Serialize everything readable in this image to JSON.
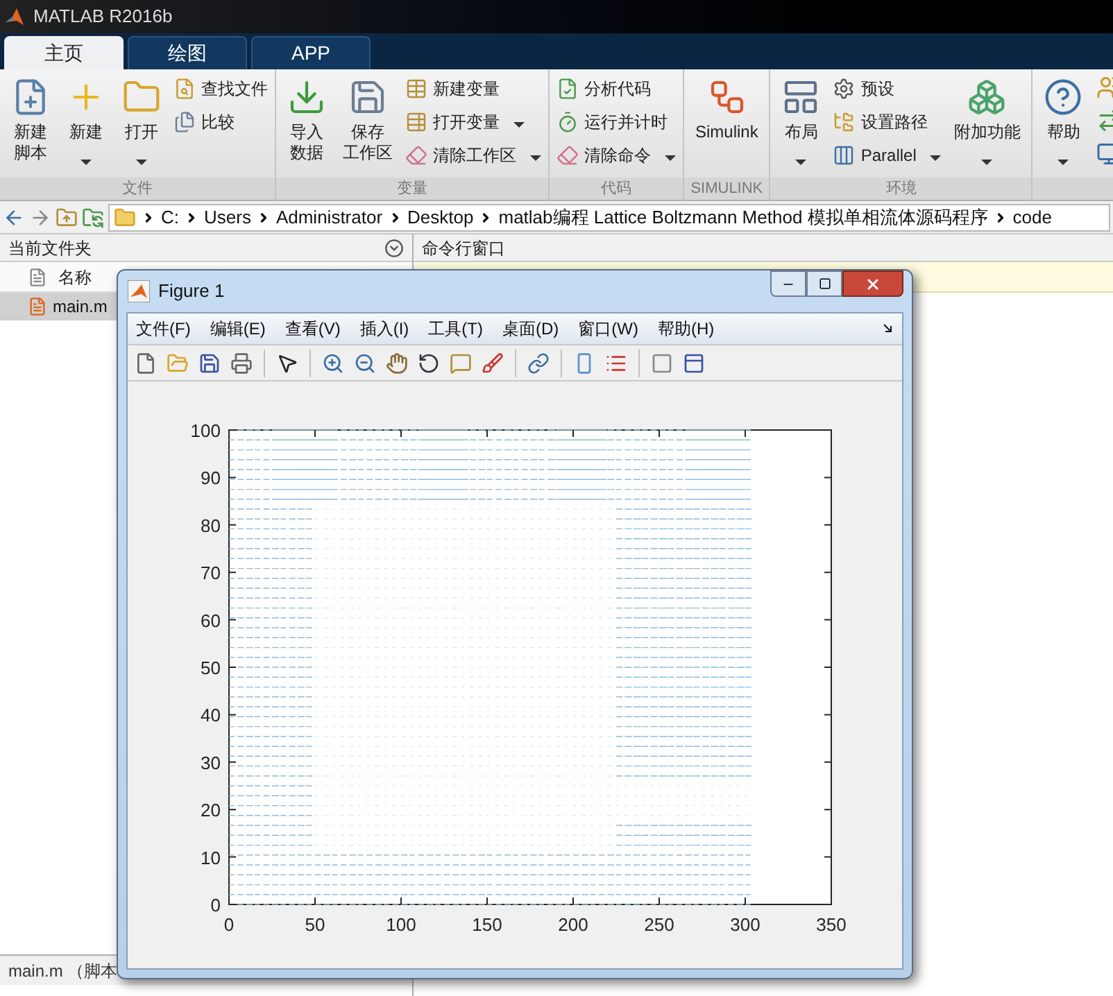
{
  "window": {
    "title": "MATLAB R2016b"
  },
  "tabs": [
    {
      "label": "主页",
      "selected": true
    },
    {
      "label": "绘图",
      "selected": false
    },
    {
      "label": "APP",
      "selected": false
    }
  ],
  "ribbon": [
    {
      "label": "文件",
      "items": [
        {
          "kind": "large",
          "lines": [
            "新建",
            "脚本"
          ],
          "dropdown": false
        },
        {
          "kind": "large",
          "lines": [
            "新建"
          ],
          "dropdown": true
        },
        {
          "kind": "large",
          "lines": [
            "打开"
          ],
          "dropdown": true
        },
        {
          "kind": "stack",
          "items": [
            {
              "label": "查找文件",
              "dropdown": false
            },
            {
              "label": "比较",
              "dropdown": false
            }
          ]
        }
      ]
    },
    {
      "label": "变量",
      "items": [
        {
          "kind": "large",
          "lines": [
            "导入",
            "数据"
          ],
          "dropdown": false
        },
        {
          "kind": "large",
          "lines": [
            "保存",
            "工作区"
          ],
          "dropdown": false
        },
        {
          "kind": "stack",
          "items": [
            {
              "label": "新建变量",
              "dropdown": false
            },
            {
              "label": "打开变量",
              "dropdown": true
            },
            {
              "label": "清除工作区",
              "dropdown": true
            }
          ]
        }
      ]
    },
    {
      "label": "代码",
      "items": [
        {
          "kind": "stack",
          "items": [
            {
              "label": "分析代码",
              "dropdown": false
            },
            {
              "label": "运行并计时",
              "dropdown": false
            },
            {
              "label": "清除命令",
              "dropdown": true
            }
          ]
        }
      ]
    },
    {
      "label": "SIMULINK",
      "items": [
        {
          "kind": "large",
          "lines": [
            "Simulink"
          ],
          "dropdown": false
        }
      ]
    },
    {
      "label": "环境",
      "items": [
        {
          "kind": "large",
          "lines": [
            "布局"
          ],
          "dropdown": true
        },
        {
          "kind": "stack",
          "items": [
            {
              "label": "预设",
              "dropdown": false
            },
            {
              "label": "设置路径",
              "dropdown": false
            },
            {
              "label": "Parallel",
              "dropdown": true
            }
          ]
        },
        {
          "kind": "large",
          "lines": [
            "附加功能"
          ],
          "dropdown": true
        }
      ]
    },
    {
      "items": [
        {
          "kind": "large",
          "lines": [
            "帮助"
          ],
          "dropdown": true
        },
        {
          "kind": "iconstack"
        }
      ]
    }
  ],
  "address": [
    "C:",
    "Users",
    "Administrator",
    "Desktop",
    "matlab编程 Lattice Boltzmann Method 模拟单相流体源码程序",
    "code"
  ],
  "current_folder": {
    "title": "当前文件夹",
    "column": "名称",
    "files": [
      {
        "name": "main.m",
        "selected": true
      }
    ],
    "details": "main.m （脚本"
  },
  "command_window": {
    "title": "命令行窗口"
  },
  "figure": {
    "title": "Figure 1",
    "menus": [
      "文件(F)",
      "编辑(E)",
      "查看(V)",
      "插入(I)",
      "工具(T)",
      "桌面(D)",
      "窗口(W)",
      "帮助(H)"
    ],
    "plot": {
      "xticks": [
        "0",
        "50",
        "100",
        "150",
        "200",
        "250",
        "300",
        "350"
      ],
      "yticks": [
        "100",
        "90",
        "80",
        "70",
        "60",
        "50",
        "40",
        "30",
        "20",
        "10",
        "0"
      ]
    }
  }
}
